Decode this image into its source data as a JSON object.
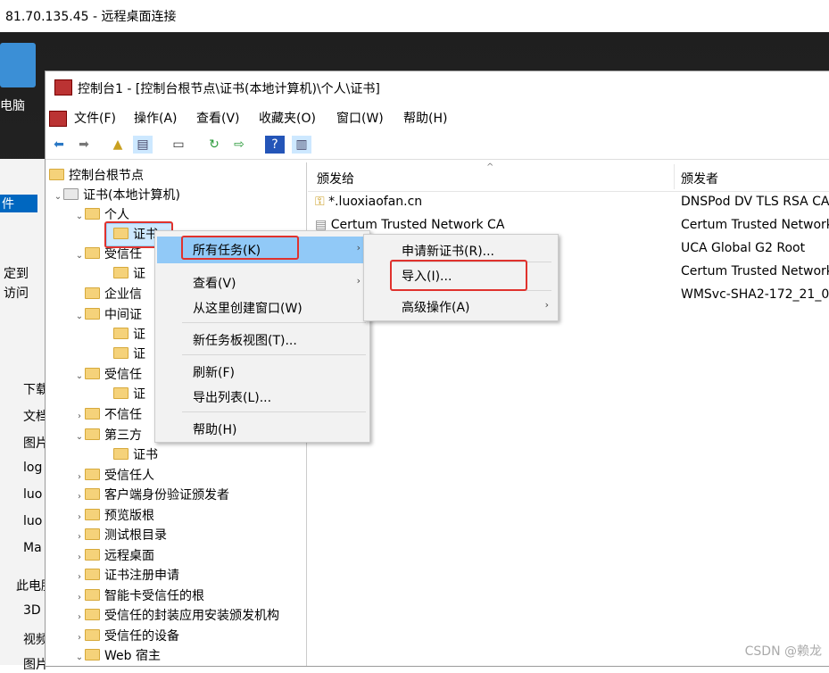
{
  "window_title": "81.70.135.45 - 远程桌面连接",
  "desktop": {
    "icon_label": "电脑"
  },
  "explorer": {
    "items": [
      "件",
      "定到",
      "访问",
      "下载",
      "文档",
      "图片",
      "log",
      "luo",
      "luo",
      "Ma",
      "此电脑",
      "3D",
      "视频",
      "图片"
    ]
  },
  "mmc": {
    "title": "控制台1 - [控制台根节点\\证书(本地计算机)\\个人\\证书]",
    "menu": [
      "文件(F)",
      "操作(A)",
      "查看(V)",
      "收藏夹(O)",
      "窗口(W)",
      "帮助(H)"
    ],
    "tree": [
      {
        "label": "控制台根节点"
      },
      {
        "label": "证书(本地计算机)"
      },
      {
        "label": "个人"
      },
      {
        "label": "证书"
      },
      {
        "label": "受信任"
      },
      {
        "label": "证"
      },
      {
        "label": "企业信"
      },
      {
        "label": "中间证"
      },
      {
        "label": "证"
      },
      {
        "label": "证"
      },
      {
        "label": "受信任"
      },
      {
        "label": "证"
      },
      {
        "label": "不信任"
      },
      {
        "label": "第三方"
      },
      {
        "label": "证书"
      },
      {
        "label": "受信任人"
      },
      {
        "label": "客户端身份验证颁发者"
      },
      {
        "label": "预览版根"
      },
      {
        "label": "测试根目录"
      },
      {
        "label": "远程桌面"
      },
      {
        "label": "证书注册申请"
      },
      {
        "label": "智能卡受信任的根"
      },
      {
        "label": "受信任的封装应用安装颁发机构"
      },
      {
        "label": "受信任的设备"
      },
      {
        "label": "Web 宿主"
      }
    ],
    "columns": {
      "issued_to": "颁发给",
      "issued_by": "颁发者"
    },
    "rows": [
      {
        "issued_to": "*.luoxiaofan.cn",
        "issued_by": "DNSPod DV TLS RSA CA"
      },
      {
        "issued_to": "Certum Trusted Network CA",
        "issued_by": "Certum Trusted Network"
      },
      {
        "issued_to": "",
        "issued_by": "UCA Global G2 Root"
      },
      {
        "issued_to": "",
        "issued_by": "Certum Trusted Network"
      },
      {
        "issued_to": "",
        "issued_by": "WMSvc-SHA2-172_21_0"
      }
    ]
  },
  "context_menu": {
    "all_tasks": "所有任务(K)",
    "view": "查看(V)",
    "new_window": "从这里创建窗口(W)",
    "new_taskpad": "新任务板视图(T)...",
    "refresh": "刷新(F)",
    "export_list": "导出列表(L)...",
    "help": "帮助(H)"
  },
  "submenu": {
    "request": "申请新证书(R)...",
    "import": "导入(I)...",
    "advanced": "高级操作(A)"
  },
  "watermark": "CSDN @赖龙",
  "colors": {
    "highlight": "#91c9f7",
    "selection": "#cde8ff",
    "annotation": "#e0322d"
  }
}
